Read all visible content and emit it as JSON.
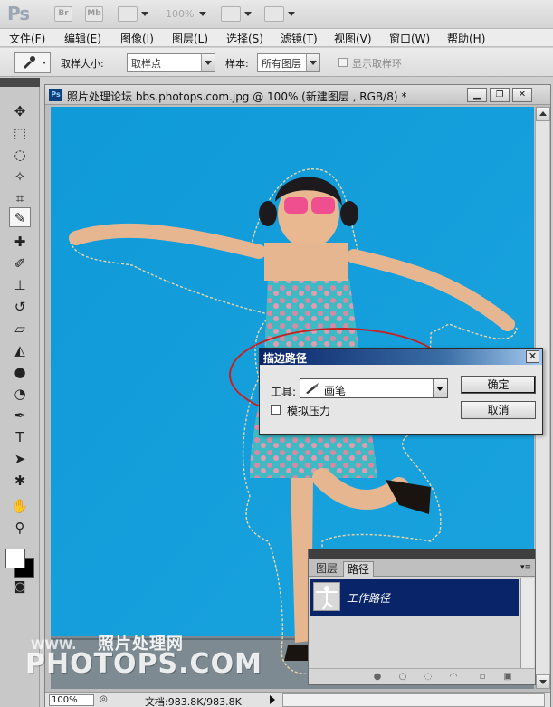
{
  "appbar": {
    "logo": "Ps",
    "bridge_label": "Br",
    "minibridge_label": "Mb",
    "zoom": "100%"
  },
  "menu": [
    "文件(F)",
    "编辑(E)",
    "图像(I)",
    "图层(L)",
    "选择(S)",
    "滤镜(T)",
    "视图(V)",
    "窗口(W)",
    "帮助(H)"
  ],
  "options": {
    "sample_size_label": "取样大小:",
    "sample_size_value": "取样点",
    "sample_label": "样本:",
    "sample_value": "所有图层",
    "show_ring_label": "显示取样环"
  },
  "document": {
    "title": "照片处理论坛 bbs.photops.com.jpg @ 100% (新建图层 , RGB/8) *",
    "status_zoom": "100%",
    "status_doc": "文档:983.8K/983.8K"
  },
  "dialog": {
    "title": "描边路径",
    "tool_label": "工具:",
    "tool_value": "画笔",
    "simulate_pressure": "模拟压力",
    "ok": "确定",
    "cancel": "取消"
  },
  "paths_panel": {
    "tab_layers": "图层",
    "tab_paths": "路径",
    "work_path": "工作路径"
  },
  "watermark": {
    "small": "WWW.",
    "cn": "照片处理网",
    "big": "PHOTOPS.COM"
  },
  "colors": {
    "canvas_bg": "#0f9ad8",
    "dialog_title": "#0a246a",
    "highlight_ellipse": "#c8201e"
  }
}
